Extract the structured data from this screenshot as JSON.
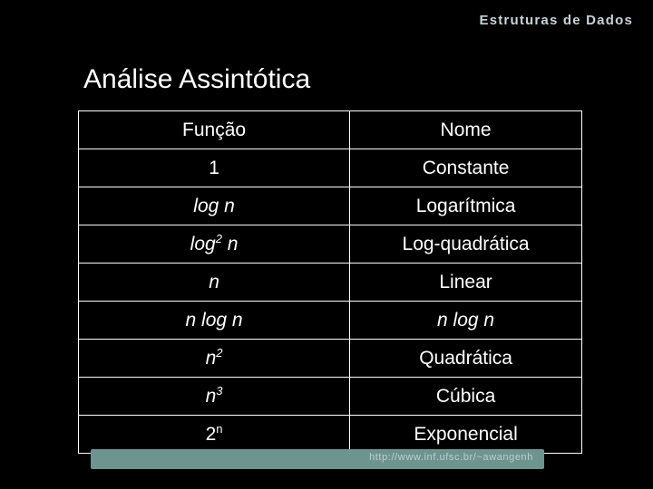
{
  "header": {
    "course_title": "Estruturas de Dados"
  },
  "slide": {
    "title": "Análise Assintótica"
  },
  "table": {
    "headers": [
      "Função",
      "Nome"
    ],
    "rows": [
      {
        "func": "1",
        "func_italic": false,
        "name": "Constante",
        "name_italic": false
      },
      {
        "func": "log n",
        "func_italic": true,
        "name": "Logarítmica",
        "name_italic": false
      },
      {
        "func": "log2 n",
        "func_italic": true,
        "name": "Log-quadrática",
        "name_italic": false
      },
      {
        "func": "n",
        "func_italic": true,
        "name": "Linear",
        "name_italic": false
      },
      {
        "func": "n log n",
        "func_italic": true,
        "name": "n log n",
        "name_italic": true
      },
      {
        "func": "n2",
        "func_italic": true,
        "name": "Quadrática",
        "name_italic": false
      },
      {
        "func": "n3",
        "func_italic": true,
        "name": "Cúbica",
        "name_italic": false
      },
      {
        "func": "2n",
        "func_italic": false,
        "name": "Exponencial",
        "name_italic": false
      }
    ]
  },
  "footer": {
    "url": "http://www.inf.ufsc.br/~awangenh"
  },
  "colors": {
    "background": "#000000",
    "frame": "#3f6560",
    "frame_inner": "#32524e",
    "text": "#ffffff",
    "urlbar": "#6e9490",
    "header_text": "#c9d4d2"
  }
}
